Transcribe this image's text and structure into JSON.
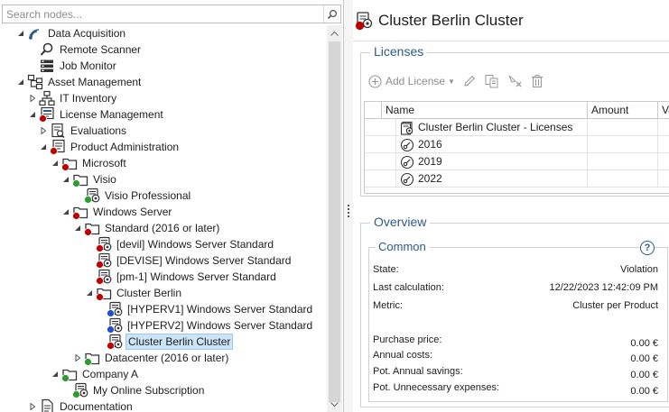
{
  "search": {
    "placeholder": "Search nodes..."
  },
  "tree": [
    {
      "label": "Data Acquisition",
      "level": 0,
      "expander": "open",
      "icon": "wifi-icon",
      "status": ""
    },
    {
      "label": "Remote Scanner",
      "level": 1,
      "expander": "",
      "icon": "magnifier-icon",
      "status": ""
    },
    {
      "label": "Job Monitor",
      "level": 1,
      "expander": "",
      "icon": "job-monitor-icon",
      "status": ""
    },
    {
      "label": "Asset Management",
      "level": 0,
      "expander": "open",
      "icon": "asset-hierarchy-icon",
      "status": ""
    },
    {
      "label": "IT Inventory",
      "level": 1,
      "expander": "closed",
      "icon": "network-icon",
      "status": ""
    },
    {
      "label": "License Management",
      "level": 1,
      "expander": "open",
      "icon": "license-management-icon",
      "status": "red"
    },
    {
      "label": "Evaluations",
      "level": 2,
      "expander": "closed",
      "icon": "evaluation-icon",
      "status": ""
    },
    {
      "label": "Product Administration",
      "level": 2,
      "expander": "open",
      "icon": "product-admin-icon",
      "status": "red"
    },
    {
      "label": "Microsoft",
      "level": 3,
      "expander": "open",
      "icon": "folder-icon",
      "status": "red"
    },
    {
      "label": "Visio",
      "level": 4,
      "expander": "open",
      "icon": "folder-icon",
      "status": "green"
    },
    {
      "label": "Visio Professional",
      "level": 5,
      "expander": "",
      "icon": "product-icon",
      "status": "green"
    },
    {
      "label": "Windows Server",
      "level": 4,
      "expander": "open",
      "icon": "folder-icon",
      "status": "red"
    },
    {
      "label": "Standard (2016 or later)",
      "level": 5,
      "expander": "open",
      "icon": "folder-icon",
      "status": "red"
    },
    {
      "label": "[devil] Windows Server Standard",
      "level": 6,
      "expander": "",
      "icon": "product-icon",
      "status": "red"
    },
    {
      "label": "[DEVISE] Windows Server Standard",
      "level": 6,
      "expander": "",
      "icon": "product-icon",
      "status": "red"
    },
    {
      "label": "[pm-1] Windows Server Standard",
      "level": 6,
      "expander": "",
      "icon": "product-icon",
      "status": "red"
    },
    {
      "label": "Cluster Berlin",
      "level": 6,
      "expander": "open",
      "icon": "folder-icon",
      "status": "red"
    },
    {
      "label": "[HYPERV1] Windows Server Standard",
      "level": 7,
      "expander": "",
      "icon": "product-icon",
      "status": "blue"
    },
    {
      "label": "[HYPERV2] Windows Server Standard",
      "level": 7,
      "expander": "",
      "icon": "product-icon",
      "status": "blue"
    },
    {
      "label": "Cluster Berlin Cluster",
      "level": 7,
      "expander": "",
      "icon": "product-icon",
      "status": "red",
      "selected": true
    },
    {
      "label": "Datacenter (2016 or later)",
      "level": 5,
      "expander": "closed",
      "icon": "folder-icon",
      "status": "green"
    },
    {
      "label": "Company A",
      "level": 3,
      "expander": "open",
      "icon": "folder-icon",
      "status": "green"
    },
    {
      "label": "My Online Subscription",
      "level": 4,
      "expander": "",
      "icon": "product-icon",
      "status": "green"
    },
    {
      "label": "Documentation",
      "level": 1,
      "expander": "closed",
      "icon": "document-icon",
      "status": ""
    }
  ],
  "detail": {
    "title": "Cluster Berlin Cluster",
    "licenses": {
      "group_title": "Licenses",
      "add_label": "Add License",
      "columns": [
        "Name",
        "Amount",
        "Va"
      ],
      "rows": [
        {
          "name": "Cluster Berlin Cluster - Licenses",
          "icon": "license-pack-icon"
        },
        {
          "name": "2016",
          "icon": "license-key-icon"
        },
        {
          "name": "2019",
          "icon": "license-key-icon"
        },
        {
          "name": "2022",
          "icon": "license-key-icon"
        }
      ]
    },
    "overview": {
      "group_title": "Overview",
      "common_title": "Common",
      "help_label": "?",
      "fields": [
        {
          "key": "State:",
          "value": "Violation"
        },
        {
          "key": "Last calculation:",
          "value": "12/22/2023 12:42:09 PM"
        },
        {
          "key": "Metric:",
          "value": "Cluster per Product"
        }
      ],
      "costs": [
        {
          "key": "Purchase price:",
          "value": "0.00 €"
        },
        {
          "key": "Annual costs:",
          "value": "0.00 €"
        },
        {
          "key": "Pot. Annual savings:",
          "value": "0.00 €"
        },
        {
          "key": "Pot. Unnecessary expenses:",
          "value": "0.00 €"
        }
      ]
    }
  },
  "colors": {
    "accent": "#2b5b8a",
    "status_red": "#c00000",
    "status_green": "#2e9b2e",
    "status_blue": "#1f4fd1",
    "folder": "#3a3a3a"
  }
}
